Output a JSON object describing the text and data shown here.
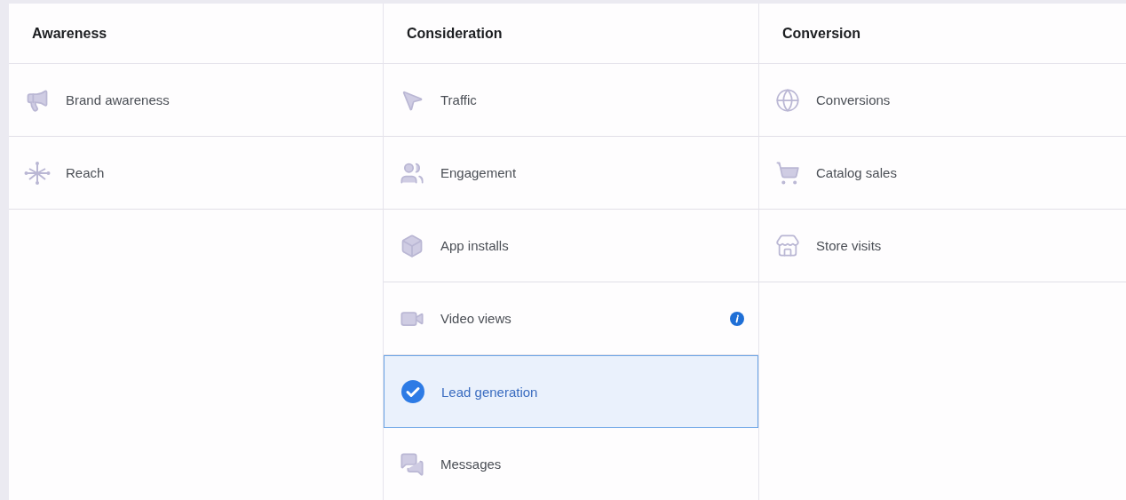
{
  "columns": [
    {
      "title": "Awareness",
      "items": [
        {
          "label": "Brand awareness",
          "kind": "megaphone",
          "selected": false,
          "info": false
        },
        {
          "label": "Reach",
          "kind": "reach",
          "selected": false,
          "info": false
        }
      ]
    },
    {
      "title": "Consideration",
      "items": [
        {
          "label": "Traffic",
          "kind": "cursor",
          "selected": false,
          "info": false
        },
        {
          "label": "Engagement",
          "kind": "people",
          "selected": false,
          "info": false
        },
        {
          "label": "App installs",
          "kind": "cube",
          "selected": false,
          "info": false
        },
        {
          "label": "Video views",
          "kind": "video",
          "selected": false,
          "info": true
        },
        {
          "label": "Lead generation",
          "selected": true,
          "info": false
        },
        {
          "label": "Messages",
          "kind": "chat",
          "selected": false,
          "info": false
        }
      ]
    },
    {
      "title": "Conversion",
      "items": [
        {
          "label": "Conversions",
          "kind": "globe",
          "selected": false,
          "info": false
        },
        {
          "label": "Catalog sales",
          "kind": "cart",
          "selected": false,
          "info": false
        },
        {
          "label": "Store visits",
          "kind": "store",
          "selected": false,
          "info": false
        }
      ]
    }
  ]
}
